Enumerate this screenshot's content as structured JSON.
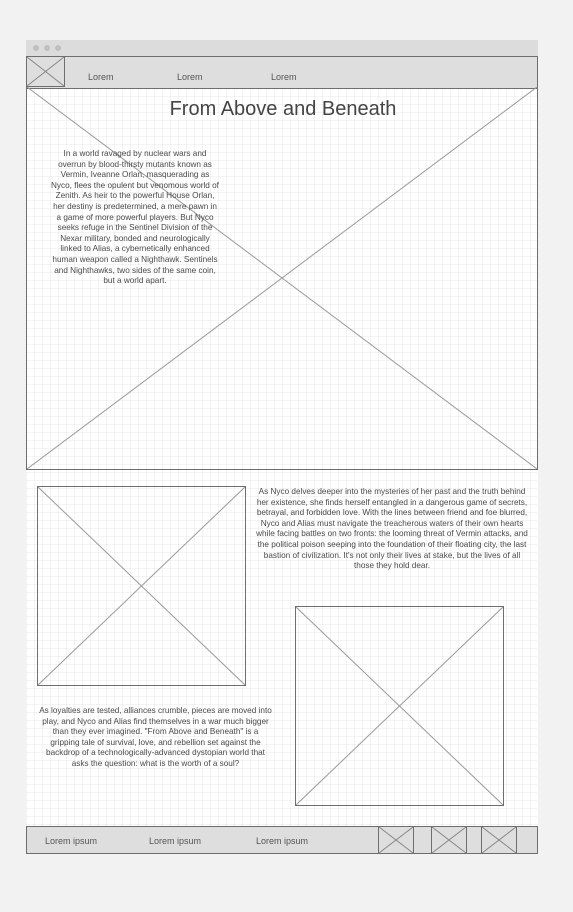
{
  "nav": {
    "links": [
      "Lorem",
      "Lorem",
      "Lorem"
    ]
  },
  "hero": {
    "title": "From Above and Beneath",
    "paragraph": "In a world ravaged by nuclear wars and overrun by blood-thirsty mutants known as Vermin, Iveanne Orlan, masquerading as Nyco, flees the opulent but venomous world of Zenith. As heir to the powerful House Orlan, her destiny is predetermined, a mere pawn in a game of more powerful players. But Nyco seeks refuge in the Sentinel Division of the Nexar military, bonded and neurologically linked to Alias, a cybernetically enhanced human weapon called a Nighthawk. Sentinels and Nighthawks, two sides of the same coin, but a world apart."
  },
  "section": {
    "paragraph_right": "As Nyco delves deeper into the mysteries of her past and the truth behind her existence, she finds herself entangled in a dangerous game of secrets, betrayal, and forbidden love. With the lines between friend and foe blurred, Nyco and Alias must navigate the treacherous waters of their own hearts while facing battles on two fronts: the looming threat of Vermin attacks, and the political poison seeping into the foundation of their floating city, the last bastion of civilization. It's not only their lives at stake, but the lives of all those they hold dear.",
    "paragraph_left": "As loyalties are tested, alliances crumble, pieces are moved into play, and Nyco and Alias find themselves in a war much bigger than they ever imagined. \"From Above and Beneath\" is a gripping tale of survival, love, and rebellion set against the backdrop of a technologically-advanced dystopian world that asks the question: what is the worth of a soul?"
  },
  "footer": {
    "links": [
      "Lorem ipsum",
      "Lorem ipsum",
      "Lorem ipsum"
    ]
  }
}
